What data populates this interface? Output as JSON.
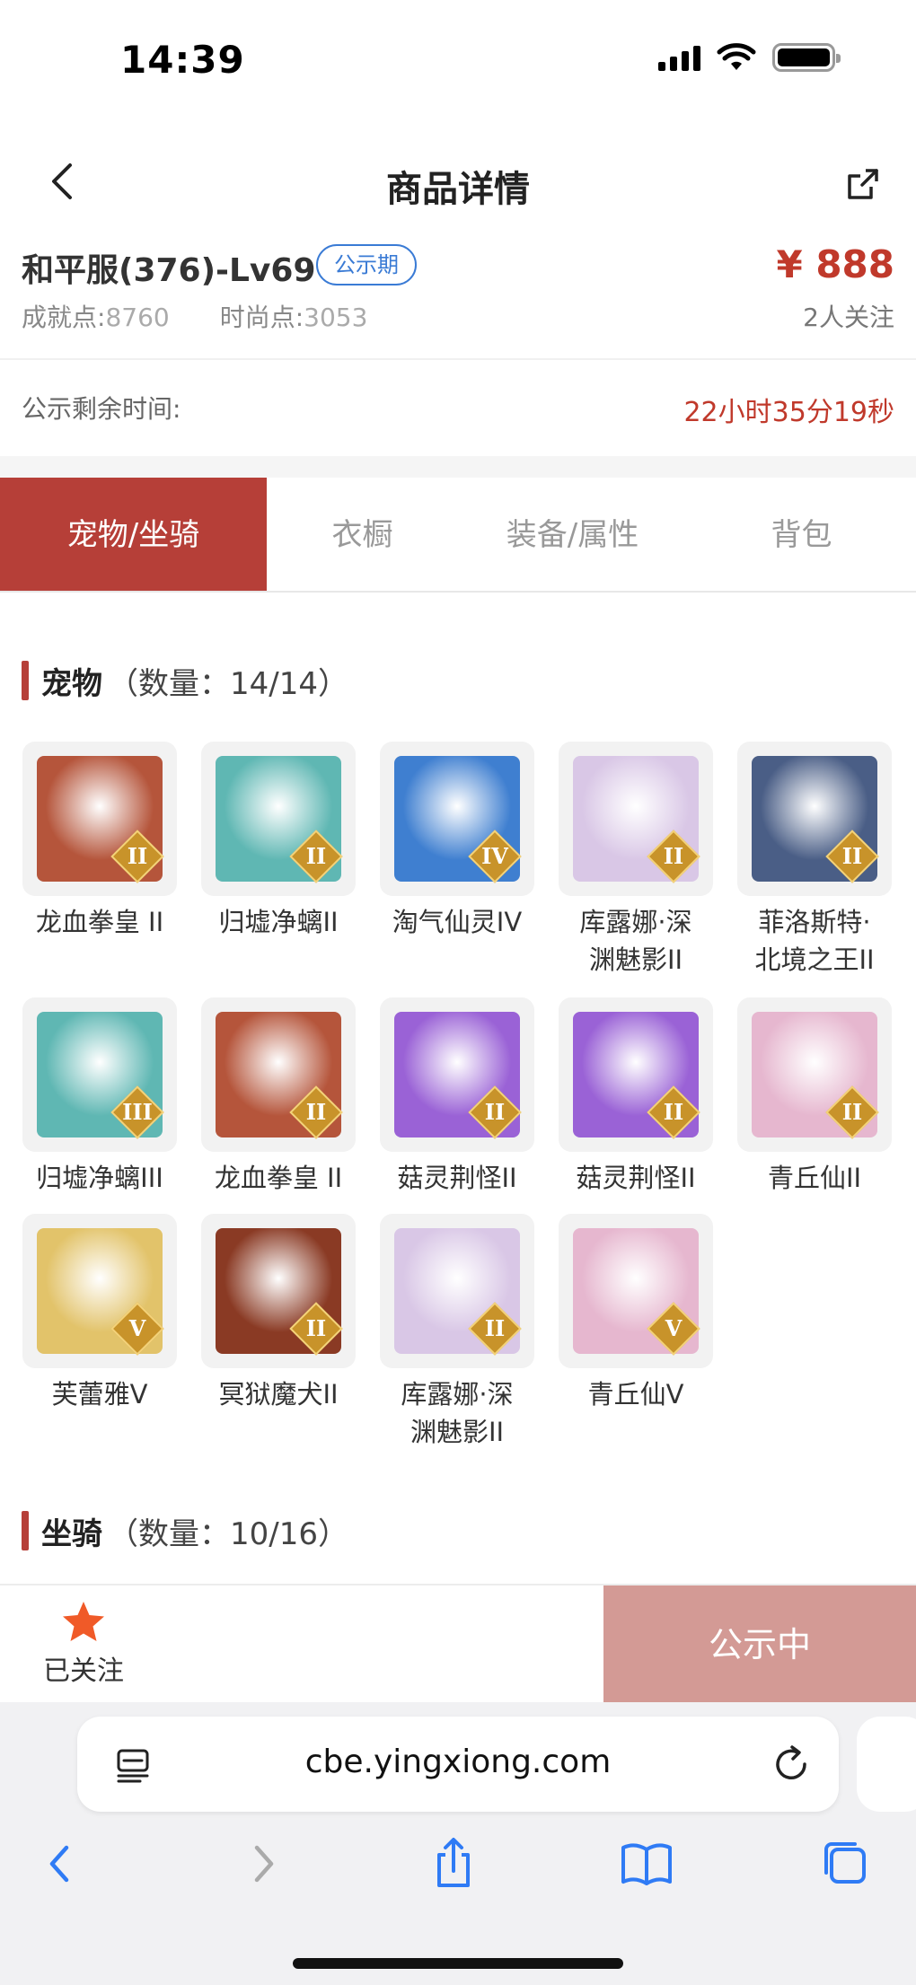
{
  "status_bar": {
    "time": "14:39"
  },
  "nav": {
    "title": "商品详情"
  },
  "product": {
    "server_name": "和平服(376)-Lv69",
    "badge": "公示期",
    "achievement_label": "成就点:",
    "achievement_value": "8760",
    "fashion_label": "时尚点:",
    "fashion_value": "3053",
    "price": "¥ 888",
    "followers": "2人关注"
  },
  "countdown": {
    "label": "公示剩余时间:",
    "value": "22小时35分19秒"
  },
  "tabs": [
    {
      "label": "宠物/坐骑",
      "active": true
    },
    {
      "label": "衣橱",
      "active": false
    },
    {
      "label": "装备/属性",
      "active": false
    },
    {
      "label": "背包",
      "active": false
    }
  ],
  "pets_section": {
    "title": "宠物",
    "count": "（数量：14/14）"
  },
  "pets": [
    {
      "name_line1": "龙血拳皇 II",
      "name_line2": "",
      "rank": "II",
      "color": "#b5553b"
    },
    {
      "name_line1": "归墟净螭II",
      "name_line2": "",
      "rank": "II",
      "color": "#5fb7b3"
    },
    {
      "name_line1": "淘气仙灵IV",
      "name_line2": "",
      "rank": "IV",
      "color": "#3f7fd0"
    },
    {
      "name_line1": "库露娜·深",
      "name_line2": "渊魅影II",
      "rank": "II",
      "color": "#d9c7e6"
    },
    {
      "name_line1": "菲洛斯特·",
      "name_line2": "北境之王II",
      "rank": "II",
      "color": "#4a5e86"
    },
    {
      "name_line1": "归墟净螭III",
      "name_line2": "",
      "rank": "III",
      "color": "#5fb7b3"
    },
    {
      "name_line1": "龙血拳皇 II",
      "name_line2": "",
      "rank": "II",
      "color": "#b5553b"
    },
    {
      "name_line1": "菇灵荆怪II",
      "name_line2": "",
      "rank": "II",
      "color": "#9a62d6"
    },
    {
      "name_line1": "菇灵荆怪II",
      "name_line2": "",
      "rank": "II",
      "color": "#9a62d6"
    },
    {
      "name_line1": "青丘仙II",
      "name_line2": "",
      "rank": "II",
      "color": "#e6b7cf"
    },
    {
      "name_line1": "芙蕾雅V",
      "name_line2": "",
      "rank": "V",
      "color": "#e2c36a"
    },
    {
      "name_line1": "冥狱魔犬II",
      "name_line2": "",
      "rank": "II",
      "color": "#8a3a24"
    },
    {
      "name_line1": "库露娜·深",
      "name_line2": "渊魅影II",
      "rank": "II",
      "color": "#d9c7e6"
    },
    {
      "name_line1": "青丘仙V",
      "name_line2": "",
      "rank": "V",
      "color": "#e6b7cf"
    }
  ],
  "mounts_section": {
    "title": "坐骑",
    "count": "（数量：10/16）"
  },
  "action_bar": {
    "follow_label": "已关注",
    "publish_label": "公示中"
  },
  "browser": {
    "url": "cbe.yingxiong.com"
  },
  "colors": {
    "accent": "#b63f38",
    "price": "#c0392b",
    "badge": "#3a7bd5",
    "publish_btn": "#d39a95",
    "star": "#f05a28"
  }
}
